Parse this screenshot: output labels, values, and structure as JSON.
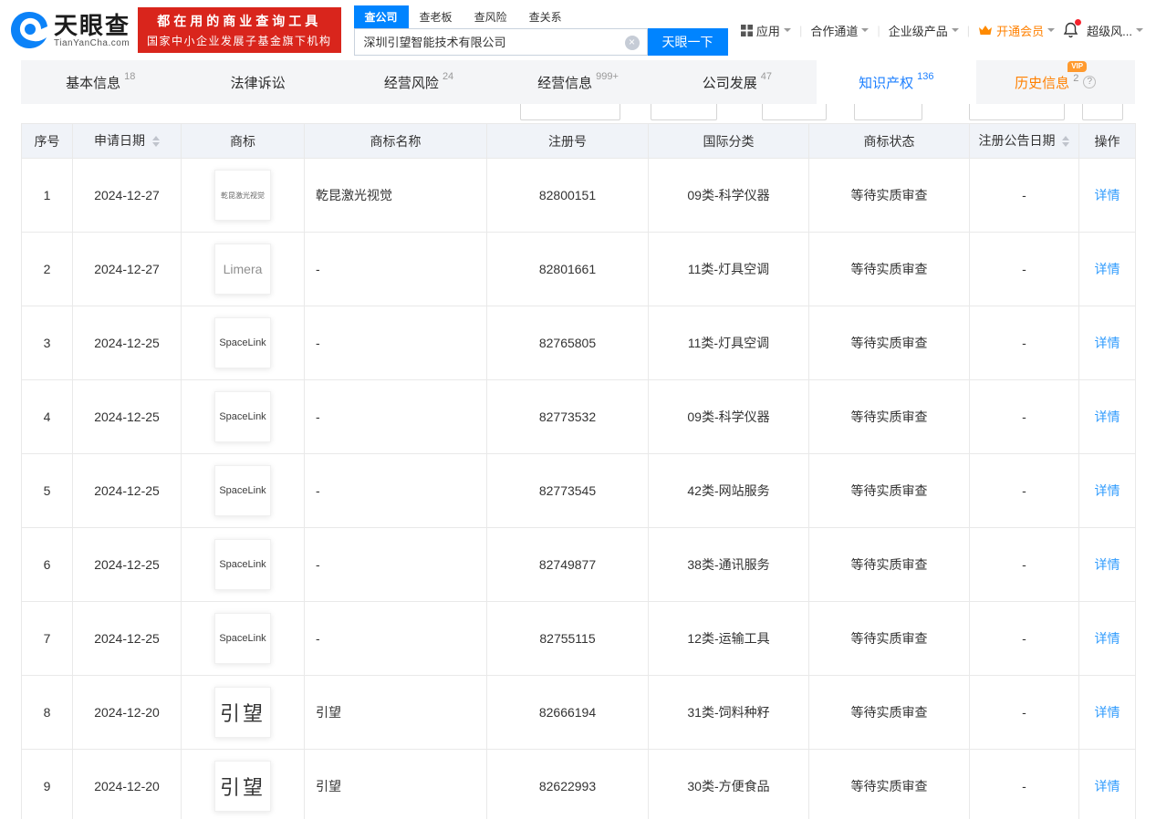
{
  "colors": {
    "brand_blue": "#0084ff",
    "badge_red": "#d9251c",
    "link_blue": "#2f9bfd",
    "vip_orange": "#ff8000",
    "active_tab_blue": "#1e80ff"
  },
  "header": {
    "logo": {
      "title": "天眼查",
      "subtitle": "TianYanCha.com"
    },
    "badge": {
      "line1": "都在用的商业查询工具",
      "line2": "国家中小企业发展子基金旗下机构"
    },
    "search_tabs": [
      {
        "label": "查公司"
      },
      {
        "label": "查老板"
      },
      {
        "label": "查风险"
      },
      {
        "label": "查关系"
      }
    ],
    "search": {
      "value": "深圳引望智能技术有限公司",
      "button_label": "天眼一下"
    },
    "nav": {
      "apps": "应用",
      "partner": "合作通道",
      "enterprise": "企业级产品",
      "membership": "开通会员",
      "super_risk": "超级风..."
    }
  },
  "tabs": [
    {
      "label": "基本信息",
      "count": "18"
    },
    {
      "label": "法律诉讼",
      "count": ""
    },
    {
      "label": "经营风险",
      "count": "24"
    },
    {
      "label": "经营信息",
      "count": "999+"
    },
    {
      "label": "公司发展",
      "count": "47"
    },
    {
      "label": "知识产权",
      "count": "136"
    },
    {
      "label": "历史信息",
      "count": "2",
      "vip_tag": "VIP"
    }
  ],
  "table": {
    "headers": [
      {
        "label": "序号"
      },
      {
        "label": "申请日期"
      },
      {
        "label": "商标"
      },
      {
        "label": "商标名称"
      },
      {
        "label": "注册号"
      },
      {
        "label": "国际分类"
      },
      {
        "label": "商标状态"
      },
      {
        "label": "注册公告日期"
      },
      {
        "label": "操作"
      }
    ],
    "rows": [
      {
        "no": "1",
        "date": "2024-12-27",
        "logo_text": "乾昆激光视觉",
        "logo_style": "tiny",
        "name": "乾昆激光视觉",
        "reg_no": "82800151",
        "intl_class": "09类-科学仪器",
        "status": "等待实质审查",
        "pub_date": "-",
        "action": "详情"
      },
      {
        "no": "2",
        "date": "2024-12-27",
        "logo_text": "Limera",
        "logo_style": "limera",
        "name": "-",
        "reg_no": "82801661",
        "intl_class": "11类-灯具空调",
        "status": "等待实质审查",
        "pub_date": "-",
        "action": "详情"
      },
      {
        "no": "3",
        "date": "2024-12-25",
        "logo_text": "SpaceLink",
        "logo_style": "spacelink",
        "name": "-",
        "reg_no": "82765805",
        "intl_class": "11类-灯具空调",
        "status": "等待实质审查",
        "pub_date": "-",
        "action": "详情"
      },
      {
        "no": "4",
        "date": "2024-12-25",
        "logo_text": "SpaceLink",
        "logo_style": "spacelink",
        "name": "-",
        "reg_no": "82773532",
        "intl_class": "09类-科学仪器",
        "status": "等待实质审查",
        "pub_date": "-",
        "action": "详情"
      },
      {
        "no": "5",
        "date": "2024-12-25",
        "logo_text": "SpaceLink",
        "logo_style": "spacelink",
        "name": "-",
        "reg_no": "82773545",
        "intl_class": "42类-网站服务",
        "status": "等待实质审查",
        "pub_date": "-",
        "action": "详情"
      },
      {
        "no": "6",
        "date": "2024-12-25",
        "logo_text": "SpaceLink",
        "logo_style": "spacelink",
        "name": "-",
        "reg_no": "82749877",
        "intl_class": "38类-通讯服务",
        "status": "等待实质审查",
        "pub_date": "-",
        "action": "详情"
      },
      {
        "no": "7",
        "date": "2024-12-25",
        "logo_text": "SpaceLink",
        "logo_style": "spacelink",
        "name": "-",
        "reg_no": "82755115",
        "intl_class": "12类-运输工具",
        "status": "等待实质审查",
        "pub_date": "-",
        "action": "详情"
      },
      {
        "no": "8",
        "date": "2024-12-20",
        "logo_text": "引望",
        "logo_style": "seal",
        "name": "引望",
        "reg_no": "82666194",
        "intl_class": "31类-饲料种籽",
        "status": "等待实质审查",
        "pub_date": "-",
        "action": "详情"
      },
      {
        "no": "9",
        "date": "2024-12-20",
        "logo_text": "引望",
        "logo_style": "seal",
        "name": "引望",
        "reg_no": "82622993",
        "intl_class": "30类-方便食品",
        "status": "等待实质审查",
        "pub_date": "-",
        "action": "详情"
      }
    ]
  }
}
